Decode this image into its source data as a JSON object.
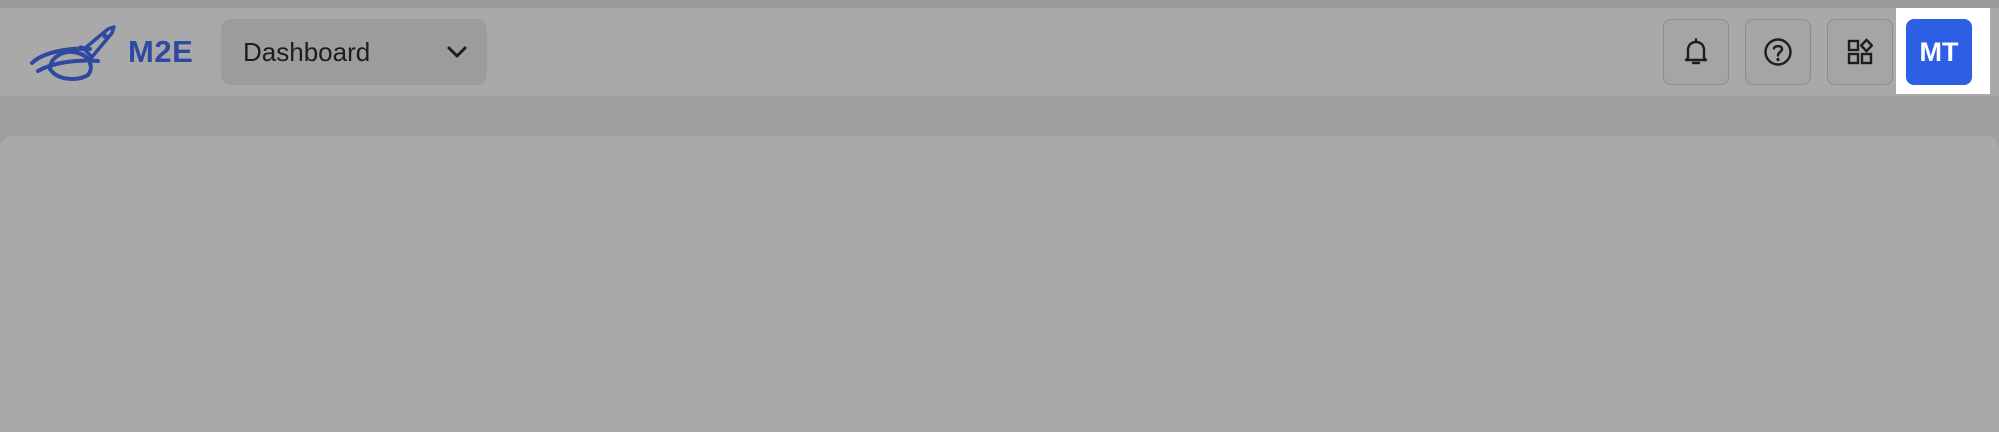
{
  "brand": {
    "logo_text": "M2E",
    "logo_color": "#2e4aa0"
  },
  "nav": {
    "selected_page": "Dashboard",
    "dropdown_icon": "chevron-down-icon"
  },
  "toolbar": {
    "buttons": [
      {
        "icon": "bell-icon"
      },
      {
        "icon": "help-circle-icon"
      },
      {
        "icon": "apps-grid-icon"
      }
    ]
  },
  "user": {
    "initials": "MT",
    "avatar_color": "#2c5fe3"
  }
}
